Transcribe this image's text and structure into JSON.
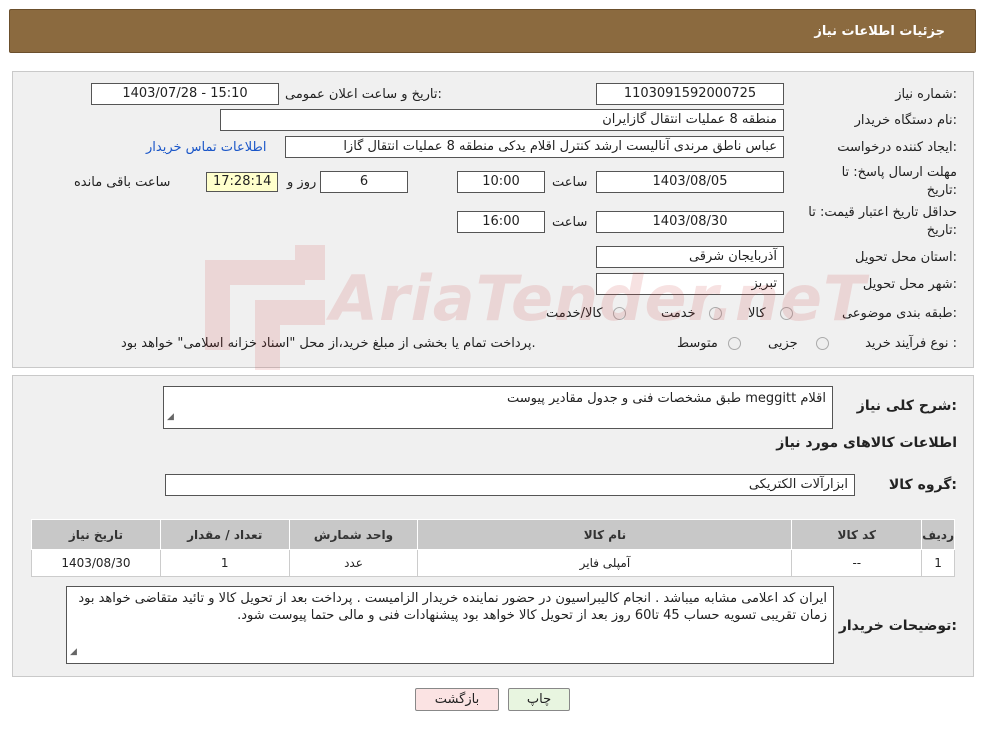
{
  "header": {
    "title": "جزئیات اطلاعات نیاز"
  },
  "form": {
    "need_number_label": "شماره نیاز:",
    "need_number": "1103091592000725",
    "announce_label": "تاریخ و ساعت اعلان عمومی:",
    "announce_value": "1403/07/28 - 15:10",
    "buyer_label": "نام دستگاه خریدار:",
    "buyer_value": "منطقه 8 عملیات انتقال گازایران",
    "creator_label": "ایجاد کننده درخواست:",
    "creator_value": "عباس ناطق مرندی آنالیست ارشد کنترل اقلام یدکی منطقه 8 عملیات انتقال گازا",
    "contact_link": "اطلاعات تماس خریدار",
    "deadline_label_1": "مهلت ارسال پاسخ: تا",
    "deadline_label_2": "تاریخ:",
    "deadline_date": "1403/08/05",
    "time_label": "ساعت",
    "deadline_time": "10:00",
    "days_value": "6",
    "days_label": "روز و",
    "remaining_time": "17:28:14",
    "remaining_label": "ساعت باقی مانده",
    "validity_label_1": "حداقل تاریخ اعتبار قیمت: تا",
    "validity_label_2": "تاریخ:",
    "validity_date": "1403/08/30",
    "validity_time": "16:00",
    "province_label": "استان محل تحویل:",
    "province_value": "آذربایجان شرقی",
    "city_label": "شهر محل تحویل:",
    "city_value": "تبریز",
    "category_label": "طبقه بندی موضوعی:",
    "category_options": [
      "کالا",
      "خدمت",
      "کالا/خدمت"
    ],
    "process_label": "نوع فرآیند خرید :",
    "process_options": [
      "جزیی",
      "متوسط"
    ],
    "process_note": "پرداخت تمام یا بخشی از مبلغ خرید،از محل \"اسناد خزانه اسلامی\" خواهد بود."
  },
  "details": {
    "summary_label": "شرح کلی نیاز:",
    "summary_value": "اقلام meggitt  طبق مشخصات فنی و جدول مقادیر پیوست",
    "goods_info_title": "اطلاعات کالاهای مورد نیاز",
    "goods_group_label": "گروه کالا:",
    "goods_group_value": "ابزارآلات الکتریکی",
    "table": {
      "headers": [
        "ردیف",
        "کد کالا",
        "نام کالا",
        "واحد شمارش",
        "تعداد / مقدار",
        "تاریخ نیاز"
      ],
      "rows": [
        [
          "1",
          "--",
          "آمپلی فایر",
          "عدد",
          "1",
          "1403/08/30"
        ]
      ]
    },
    "buyer_notes_label": "توضیحات خریدار:",
    "buyer_notes_value": "ایران کد اعلامی مشابه میباشد . انجام کالیبراسیون در حضور نماینده خریدار الزامیست . پرداخت  بعد از تحویل کالا و تائید متقاضی خواهد بود زمان  تقریبی تسویه حساب 45 تا60 روز بعد از تحویل کالا خواهد بود پیشنهادات فنی و مالی حتما پیوست شود."
  },
  "buttons": {
    "print": "چاپ",
    "back": "بازگشت"
  },
  "colors": {
    "header_bg": "#8b6a3f",
    "print_bg": "#e8f5e0",
    "back_bg": "#fbe3e3",
    "link": "#1a56c8"
  },
  "watermark_text": "AriaTender.neT"
}
